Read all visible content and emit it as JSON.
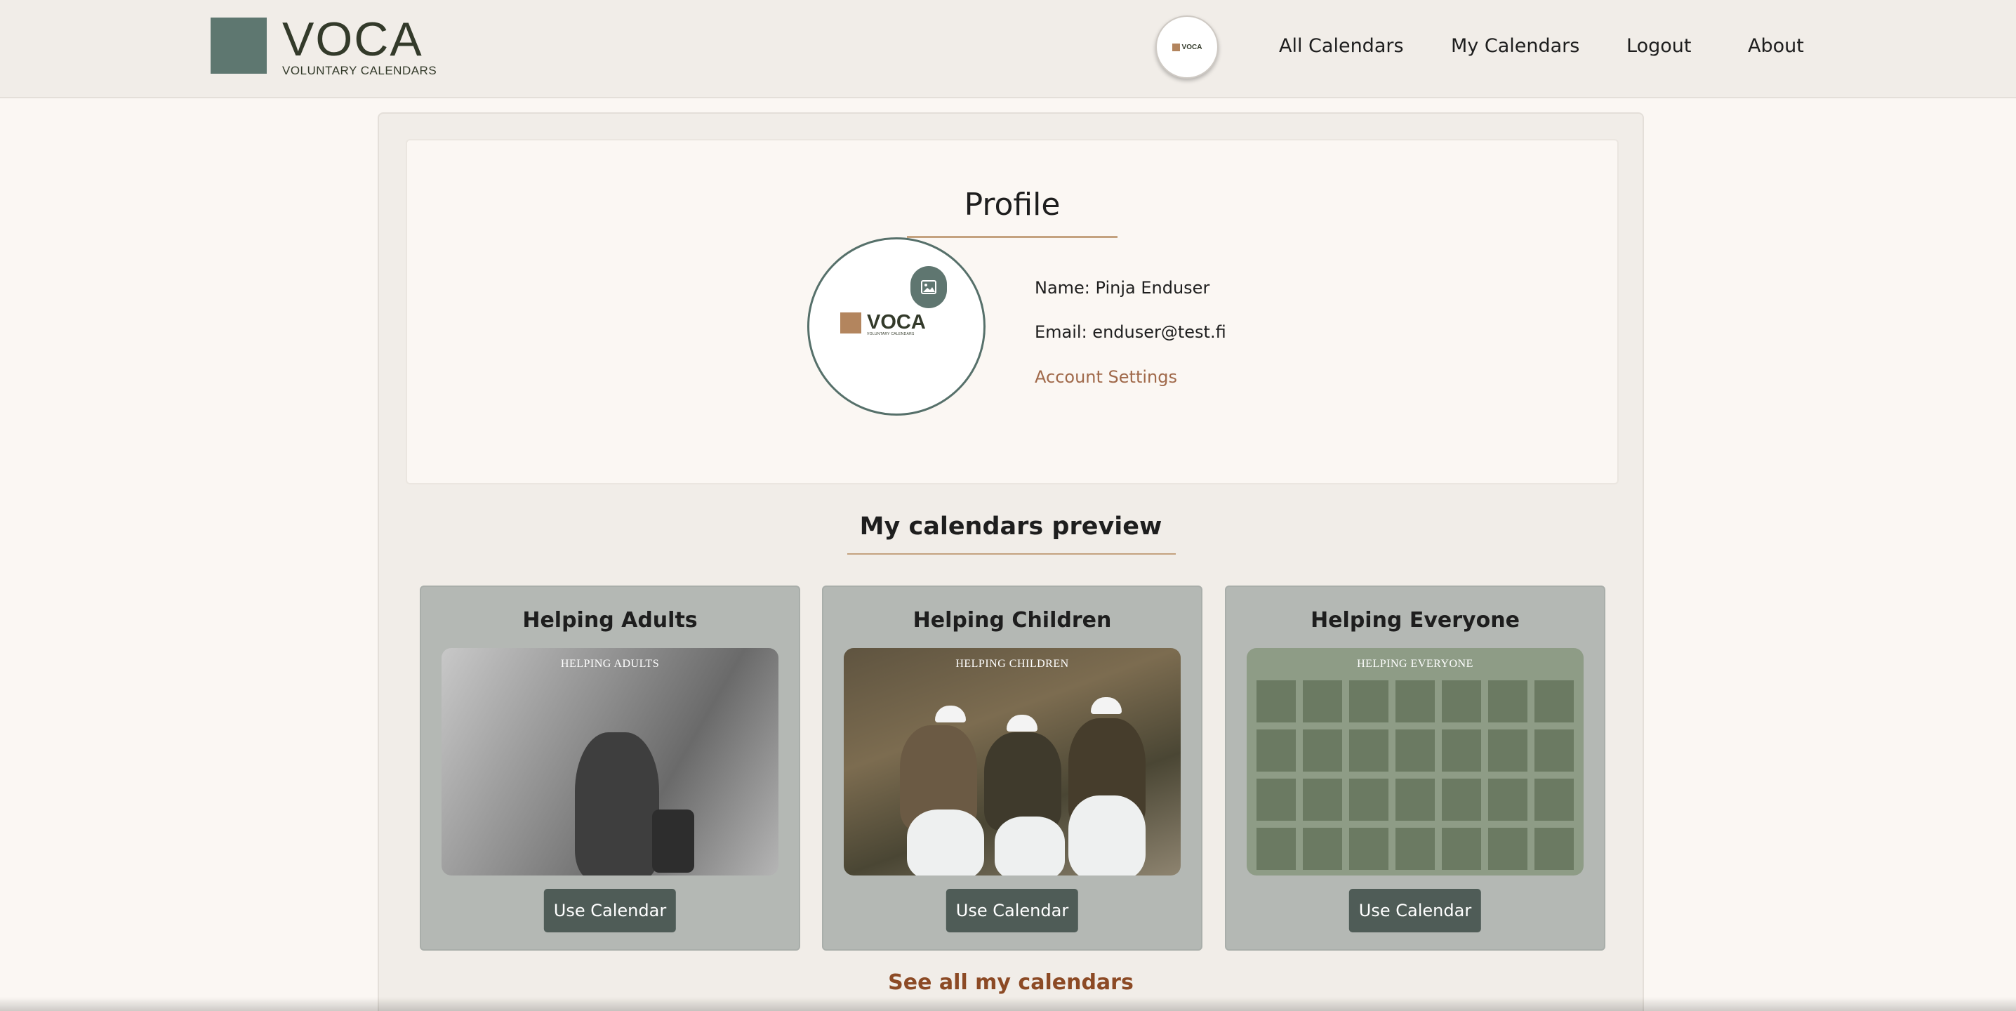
{
  "brand": {
    "title": "VOCA",
    "subtitle": "VOLUNTARY CALENDARS",
    "avatar_logo_text": "VOCA"
  },
  "nav": {
    "all_calendars": "All Calendars",
    "my_calendars": "My Calendars",
    "logout": "Logout",
    "about": "About"
  },
  "profile": {
    "title": "Profile",
    "logo_title": "VOCA",
    "logo_subtitle": "VOLUNTARY CALENDARS",
    "name_line": "Name: Pinja Enduser",
    "email_line": "Email: enduser@test.fi",
    "account_settings": "Account Settings"
  },
  "calendars": {
    "section_title": "My calendars preview",
    "items": [
      {
        "title": "Helping Adults",
        "thumb_caption": "HELPING ADULTS",
        "button": "Use Calendar"
      },
      {
        "title": "Helping Children",
        "thumb_caption": "HELPING CHILDREN",
        "button": "Use Calendar"
      },
      {
        "title": "Helping Everyone",
        "thumb_caption": "HELPING EVERYONE",
        "button": "Use Calendar"
      }
    ],
    "see_all": "See all my calendars"
  },
  "colors": {
    "brand_square": "#5e7770",
    "accent_brown": "#b3855e",
    "link_brown": "#a0694a",
    "see_all_brown": "#8c4a25",
    "button_dark": "#4f5c57",
    "card_gray": "#b4b8b4"
  },
  "icons": {
    "change_photo": "image-icon"
  }
}
